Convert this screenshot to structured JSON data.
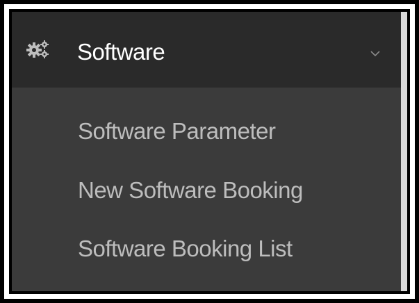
{
  "menu": {
    "header": {
      "label": "Software",
      "icon": "gears-icon",
      "expand_icon": "chevron-down-icon"
    },
    "items": [
      {
        "label": "Software Parameter"
      },
      {
        "label": "New Software Booking"
      },
      {
        "label": "Software Booking List"
      }
    ]
  },
  "colors": {
    "header_bg": "#2a2a2a",
    "submenu_bg": "#3b3b3b",
    "header_text": "#ffffff",
    "submenu_text": "#bdbdbd"
  }
}
